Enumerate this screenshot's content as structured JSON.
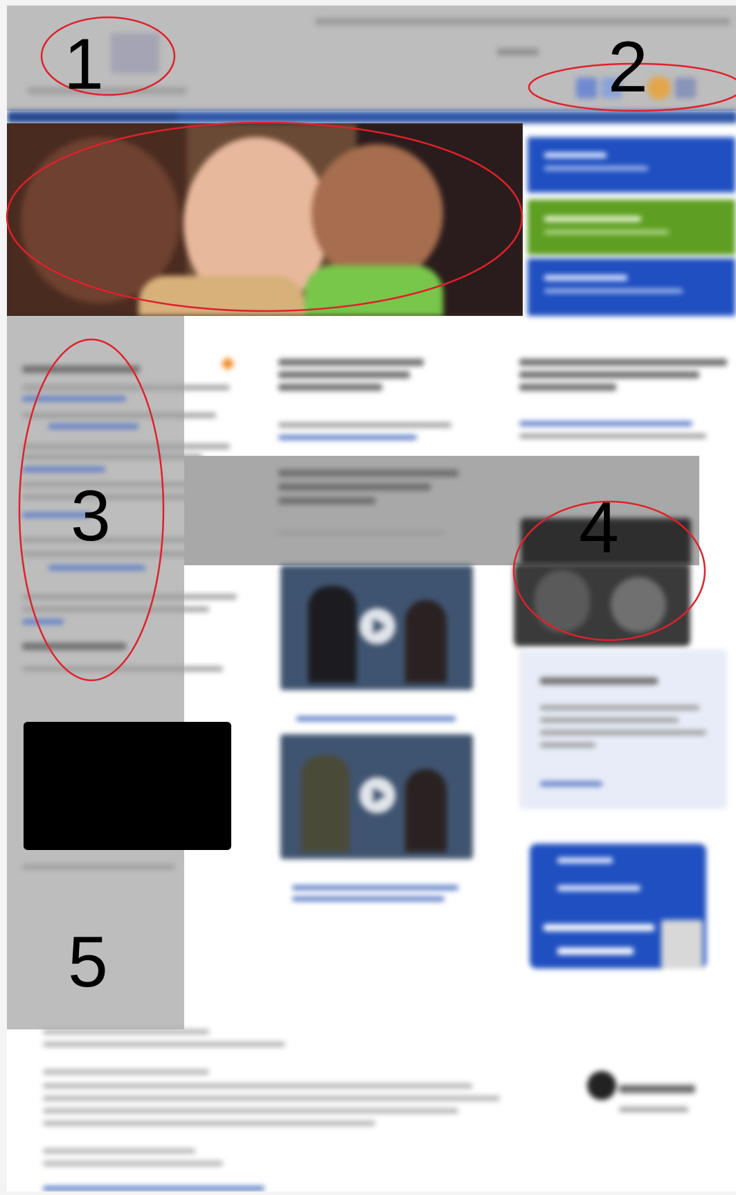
{
  "annotations": {
    "color": "#e0202a",
    "labels": [
      "1",
      "2",
      "3",
      "4",
      "5"
    ]
  },
  "colors": {
    "header": "#bdbdbd",
    "nav_blue": "#2f57a8",
    "tile_blue": "#1f4fc0",
    "tile_green": "#5e9e22",
    "overlay_grey": "#bdbdbd",
    "black_block": "#000000",
    "feature_orange": "#f08a24"
  },
  "icons": [
    "play-icon",
    "star-icon"
  ]
}
